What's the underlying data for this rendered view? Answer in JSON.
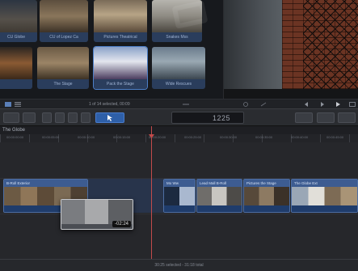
{
  "browser": {
    "row1_captions": [
      "CU Globe",
      "CU of Lopez Ca",
      "Pictures Theatrical",
      "Snakes Mss"
    ],
    "row2_captions": [
      "",
      "The Stage",
      "Pack the Stage",
      "Wide Rescues"
    ],
    "status": "1 of 14 selected, 00:09"
  },
  "viewer": {},
  "toolbar": {
    "timecode": "1225"
  },
  "timeline": {
    "project_name": "The Globe",
    "ruler_labels": [
      "00:00:00:00",
      "00:00:05:00",
      "00:00:10:00",
      "00:00:15:00",
      "00:00:20:00",
      "00:00:25:00",
      "00:00:30:00",
      "00:00:35:00",
      "00:00:40:00",
      "00:00:45:00"
    ],
    "clips": [
      {
        "label": "B-Roll Exterior"
      },
      {
        "label": "Mo Ww"
      },
      {
        "label": "Lead Mall B-Roll"
      },
      {
        "label": "Pictures the Stage"
      },
      {
        "label": "The Globe Ext"
      }
    ],
    "drag_time": "-02:24"
  },
  "status_bar": {
    "text": "30:25 selected - 31:18 total"
  }
}
